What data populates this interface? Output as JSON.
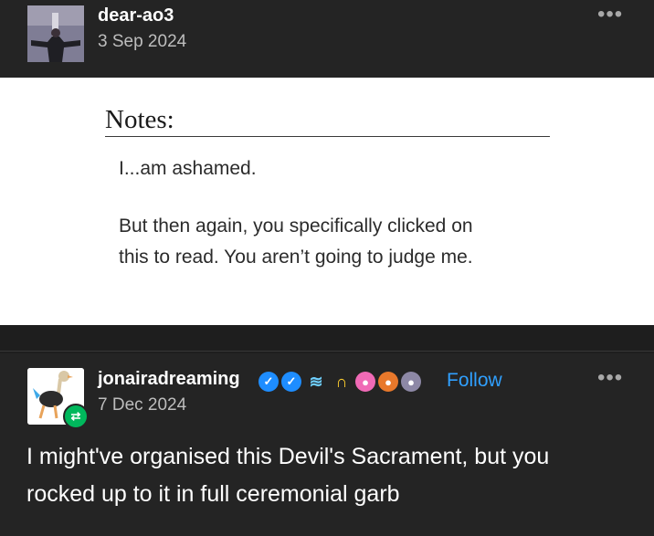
{
  "post1": {
    "username": "dear-ao3",
    "date": "3 Sep 2024",
    "avatar": "person-with-arms-raised-icon",
    "menu": "•••"
  },
  "notes": {
    "title": "Notes:",
    "lines": [
      "I...am ashamed.",
      "But then again, you specifically clicked on",
      "this to read. You aren’t going to judge me."
    ]
  },
  "post2": {
    "username": "jonairadreaming",
    "date": "7 Dec 2024",
    "avatar": "ostrich-icon",
    "reblog_badge": "reblog-icon",
    "follow_label": "Follow",
    "menu": "•••",
    "badges": [
      "verified-icon",
      "verified-icon",
      "stack-icon",
      "headphones-icon",
      "pink-pal-icon",
      "orange-pal-icon",
      "gray-pal-icon"
    ],
    "body_lines": [
      "I might've organised this Devil's Sacrament, but you",
      "rocked up to it in full ceremonial garb"
    ]
  },
  "colors": {
    "background": "#242424",
    "notes_background": "#ffffff",
    "follow": "#30a0ff",
    "verified": "#1e8dff",
    "reblog": "#00b85c"
  }
}
